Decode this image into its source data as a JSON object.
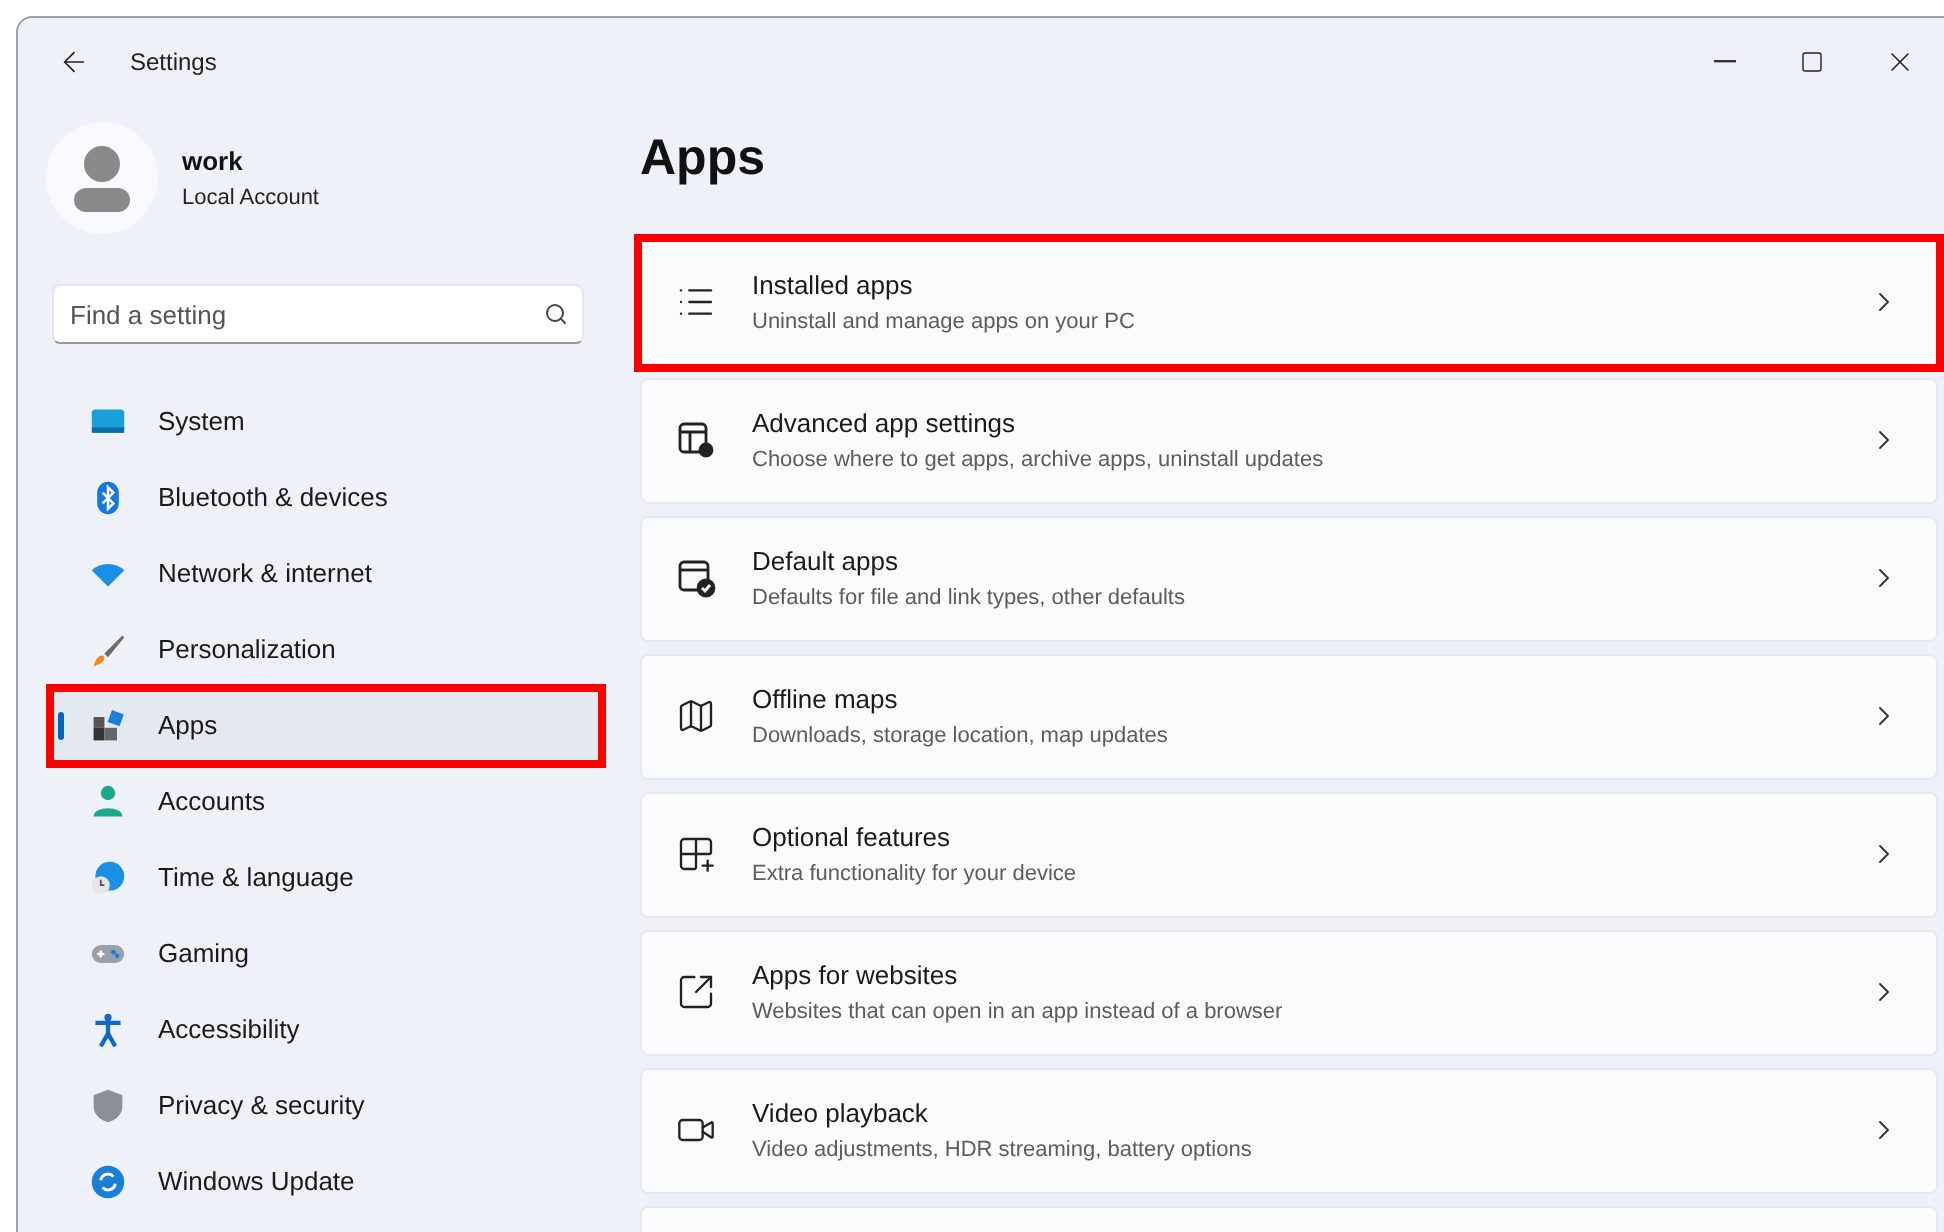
{
  "window": {
    "title": "Settings"
  },
  "account": {
    "name": "work",
    "type": "Local Account"
  },
  "search": {
    "placeholder": "Find a setting"
  },
  "nav": [
    {
      "label": "System",
      "selected": false,
      "highlighted": false
    },
    {
      "label": "Bluetooth & devices",
      "selected": false,
      "highlighted": false
    },
    {
      "label": "Network & internet",
      "selected": false,
      "highlighted": false
    },
    {
      "label": "Personalization",
      "selected": false,
      "highlighted": false
    },
    {
      "label": "Apps",
      "selected": true,
      "highlighted": true
    },
    {
      "label": "Accounts",
      "selected": false,
      "highlighted": false
    },
    {
      "label": "Time & language",
      "selected": false,
      "highlighted": false
    },
    {
      "label": "Gaming",
      "selected": false,
      "highlighted": false
    },
    {
      "label": "Accessibility",
      "selected": false,
      "highlighted": false
    },
    {
      "label": "Privacy & security",
      "selected": false,
      "highlighted": false
    },
    {
      "label": "Windows Update",
      "selected": false,
      "highlighted": false
    }
  ],
  "page": {
    "title": "Apps"
  },
  "cards": [
    {
      "title": "Installed apps",
      "subtitle": "Uninstall and manage apps on your PC",
      "highlighted": true
    },
    {
      "title": "Advanced app settings",
      "subtitle": "Choose where to get apps, archive apps, uninstall updates",
      "highlighted": false
    },
    {
      "title": "Default apps",
      "subtitle": "Defaults for file and link types, other defaults",
      "highlighted": false
    },
    {
      "title": "Offline maps",
      "subtitle": "Downloads, storage location, map updates",
      "highlighted": false
    },
    {
      "title": "Optional features",
      "subtitle": "Extra functionality for your device",
      "highlighted": false
    },
    {
      "title": "Apps for websites",
      "subtitle": "Websites that can open in an app instead of a browser",
      "highlighted": false
    },
    {
      "title": "Video playback",
      "subtitle": "Video adjustments, HDR streaming, battery options",
      "highlighted": false
    }
  ]
}
